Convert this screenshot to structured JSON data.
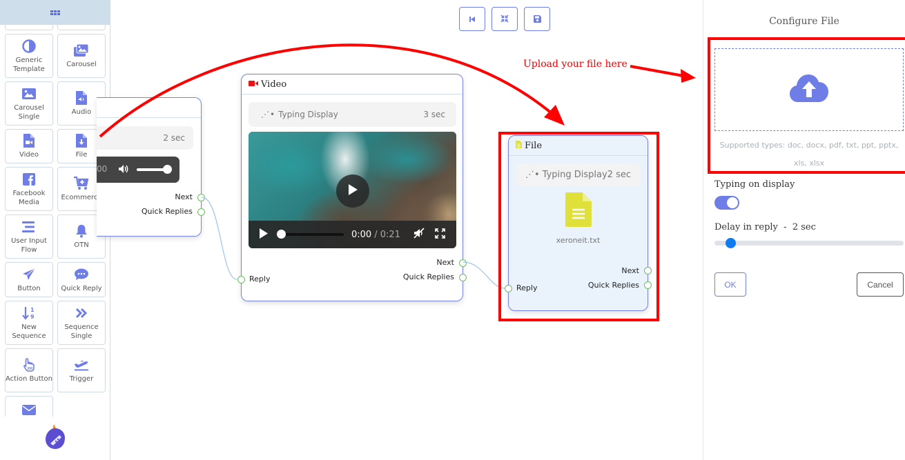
{
  "sidebar": {
    "header_icon": "grid-icon",
    "items": [
      {
        "label": "Generic Template",
        "icon": "half-circle-icon"
      },
      {
        "label": "Carousel",
        "icon": "images-icon"
      },
      {
        "label": "Carousel Single",
        "icon": "image-icon"
      },
      {
        "label": "Audio",
        "icon": "file-audio-icon"
      },
      {
        "label": "Video",
        "icon": "file-video-icon"
      },
      {
        "label": "File",
        "icon": "file-download-icon"
      },
      {
        "label": "Facebook Media",
        "icon": "facebook-icon"
      },
      {
        "label": "Ecommerce",
        "icon": "cart-plus-icon"
      },
      {
        "label": "User Input Flow",
        "icon": "lines-icon"
      },
      {
        "label": "OTN",
        "icon": "bell-icon"
      },
      {
        "label": "Button",
        "icon": "paper-plane-icon"
      },
      {
        "label": "Quick Reply",
        "icon": "chat-bubble-icon"
      },
      {
        "label": "New Sequence",
        "icon": "sort-numeric-icon"
      },
      {
        "label": "Sequence Single",
        "icon": "double-chevron-icon"
      },
      {
        "label": "Action Button",
        "icon": "hand-pointer-icon"
      },
      {
        "label": "Trigger",
        "icon": "plane-departure-icon"
      },
      {
        "label": "",
        "icon": "envelope-icon"
      }
    ]
  },
  "toolbar": {
    "buttons": [
      {
        "name": "reset",
        "icon": "step-backward-icon"
      },
      {
        "name": "fit",
        "icon": "compress-icon"
      },
      {
        "name": "save",
        "icon": "floppy-disk-icon"
      }
    ]
  },
  "nodes": {
    "audio": {
      "typing_delay": "2 sec",
      "time_fragment": "00",
      "volume_fraction": 1.0,
      "ports": {
        "next": "Next",
        "quick_replies": "Quick Replies"
      }
    },
    "video": {
      "title": "Video",
      "typing_label": "Typing Display",
      "typing_delay": "3 sec",
      "current_time": "0:00",
      "duration": "/ 0:21",
      "progress_fraction": 0.0,
      "ports": {
        "reply": "Reply",
        "next": "Next",
        "quick_replies": "Quick Replies"
      }
    },
    "file": {
      "title": "File",
      "typing_label": "Typing Display2 sec",
      "file_name": "xeroneit.txt",
      "ports": {
        "reply": "Reply",
        "next": "Next",
        "quick_replies": "Quick Replies"
      }
    }
  },
  "annotation": {
    "text": "Upload your file here",
    "color": "#ff0000"
  },
  "panel": {
    "title": "Configure File",
    "supported_types": "Supported types: doc, docx, pdf, txt, ppt, pptx, xls, xlsx",
    "typing_label": "Typing on display",
    "typing_enabled": true,
    "delay_label": "Delay in reply  -  2 sec",
    "delay_value_sec": 2,
    "delay_fraction": 0.06,
    "ok_label": "OK",
    "cancel_label": "Cancel"
  },
  "colors": {
    "accent": "#6f7ee6",
    "port": "#6abf5e",
    "highlight": "#ff0000",
    "file_icon": "#dfe03a",
    "video_icon": "#ee1111",
    "slider_knob": "#0d7bf2"
  }
}
